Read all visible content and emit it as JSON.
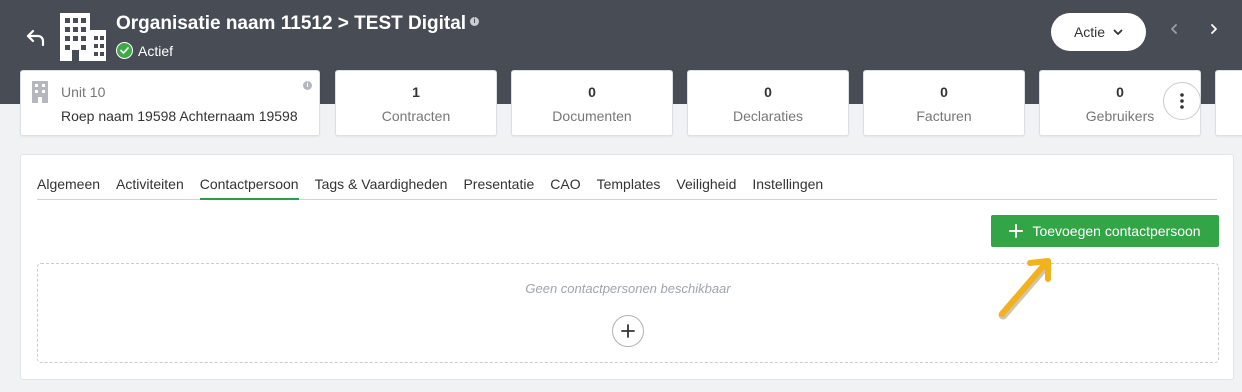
{
  "header": {
    "title": "Organisatie naam 11512 > TEST Digital",
    "status": "Actief",
    "action_button": "Actie",
    "status_color": "#3ea84a"
  },
  "unit": {
    "name": "Unit 10",
    "person": "Roep naam 19598 Achternaam 19598"
  },
  "stats": [
    {
      "count": "1",
      "label": "Contracten"
    },
    {
      "count": "0",
      "label": "Documenten"
    },
    {
      "count": "0",
      "label": "Declaraties"
    },
    {
      "count": "0",
      "label": "Facturen"
    },
    {
      "count": "0",
      "label": "Gebruikers"
    }
  ],
  "tabs": [
    {
      "label": "Algemeen"
    },
    {
      "label": "Activiteiten"
    },
    {
      "label": "Contactpersoon"
    },
    {
      "label": "Tags & Vaardigheden"
    },
    {
      "label": "Presentatie"
    },
    {
      "label": "CAO"
    },
    {
      "label": "Templates"
    },
    {
      "label": "Veiligheid"
    },
    {
      "label": "Instellingen"
    }
  ],
  "active_tab": "Contactpersoon",
  "content": {
    "add_button": "Toevoegen contactpersoon",
    "empty_text": "Geen contactpersonen beschikbaar"
  },
  "colors": {
    "header_bg": "#474c55",
    "accent_green": "#32a546",
    "annotation_arrow": "#f2b21c"
  }
}
